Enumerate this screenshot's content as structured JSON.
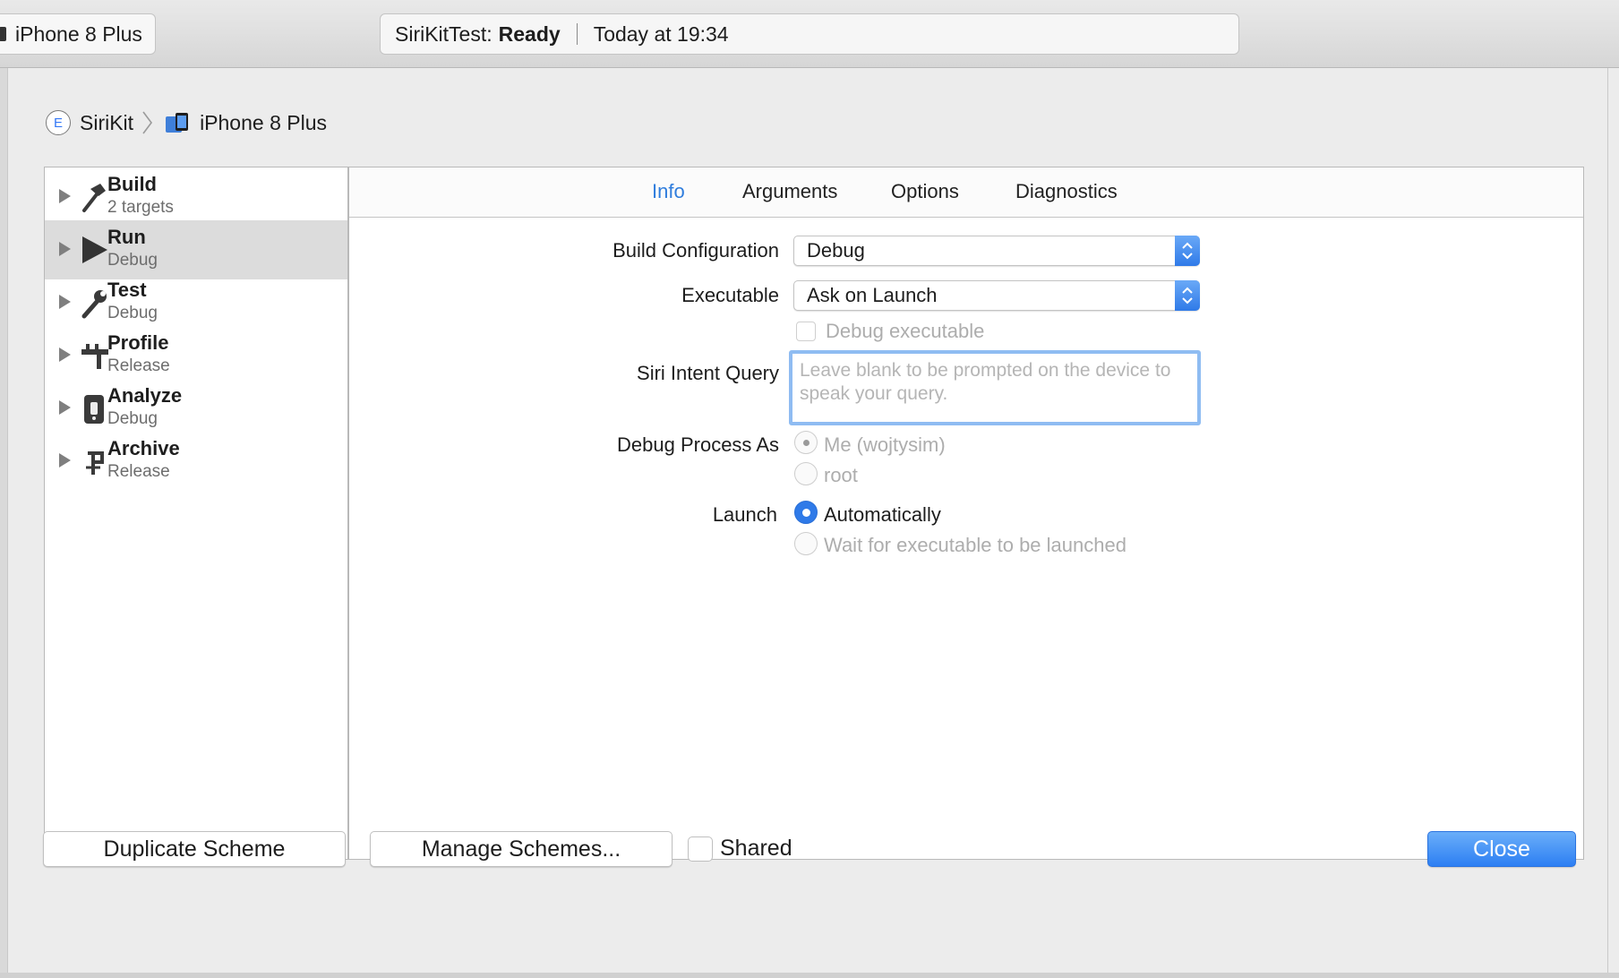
{
  "toolbar": {
    "device": "iPhone 8 Plus",
    "status_project": "SiriKitTest:",
    "status_state": "Ready",
    "status_time": "Today at 19:34"
  },
  "breadcrumb": {
    "scheme": "SiriKit",
    "scheme_icon_letter": "E",
    "destination": "iPhone 8 Plus"
  },
  "actions": [
    {
      "name": "Build",
      "sub": "2 targets",
      "icon": "hammer-icon"
    },
    {
      "name": "Run",
      "sub": "Debug",
      "icon": "play-icon",
      "selected": true
    },
    {
      "name": "Test",
      "sub": "Debug",
      "icon": "wrench-icon"
    },
    {
      "name": "Profile",
      "sub": "Release",
      "icon": "gauge-icon"
    },
    {
      "name": "Analyze",
      "sub": "Debug",
      "icon": "analyze-icon"
    },
    {
      "name": "Archive",
      "sub": "Release",
      "icon": "archive-icon"
    }
  ],
  "tabs": [
    "Info",
    "Arguments",
    "Options",
    "Diagnostics"
  ],
  "active_tab": "Info",
  "info": {
    "build_configuration_label": "Build Configuration",
    "build_configuration_value": "Debug",
    "executable_label": "Executable",
    "executable_value": "Ask on Launch",
    "debug_executable_label": "Debug executable",
    "siri_query_label": "Siri Intent Query",
    "siri_query_placeholder": "Leave blank to be prompted on the device to speak your query.",
    "debug_process_label": "Debug Process As",
    "debug_process_options": [
      "Me (wojtysim)",
      "root"
    ],
    "launch_label": "Launch",
    "launch_options": [
      "Automatically",
      "Wait for executable to be launched"
    ]
  },
  "footer": {
    "duplicate": "Duplicate Scheme",
    "manage": "Manage Schemes...",
    "shared": "Shared",
    "close": "Close"
  },
  "colors": {
    "accent": "#2f7ae8",
    "active_tab": "#2f7ddd",
    "selection": "#dcdcdc"
  }
}
